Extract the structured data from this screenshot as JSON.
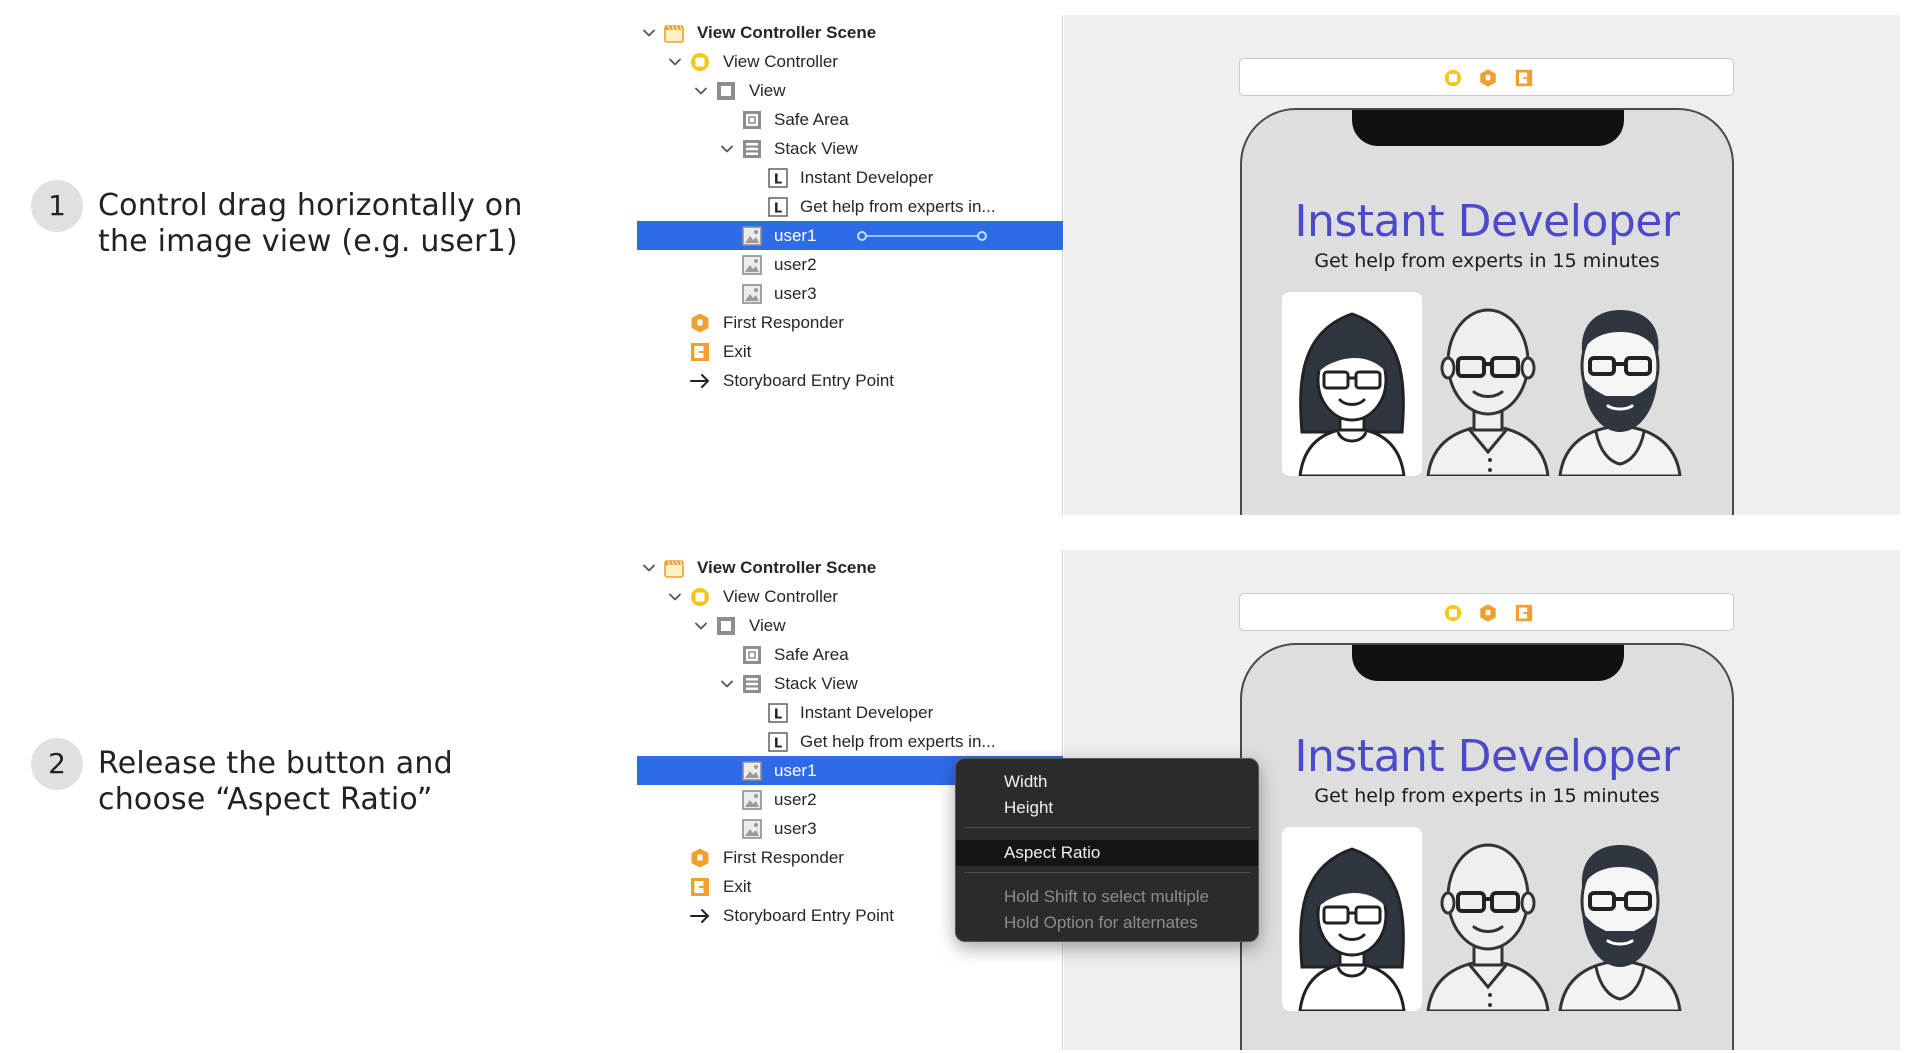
{
  "steps": [
    {
      "number": "1",
      "text_line1": "Control drag horizontally on",
      "text_line2": "the image view (e.g. user1)"
    },
    {
      "number": "2",
      "text_line1": "Release the button and",
      "text_line2": "choose “Aspect Ratio”"
    }
  ],
  "outline": {
    "scene": "View Controller Scene",
    "view_controller": "View Controller",
    "view": "View",
    "safe_area": "Safe Area",
    "stack_view": "Stack View",
    "label1": "Instant Developer",
    "label2": "Get help from experts in...",
    "user1": "user1",
    "user2": "user2",
    "user3": "user3",
    "first_responder": "First Responder",
    "exit": "Exit",
    "entry_point": "Storyboard Entry Point"
  },
  "app": {
    "title": "Instant Developer",
    "subtitle": "Get help from experts in 15 minutes"
  },
  "menu": {
    "width": "Width",
    "height": "Height",
    "aspect_ratio": "Aspect Ratio",
    "hint1": "Hold Shift to select multiple",
    "hint2": "Hold Option for alternates"
  },
  "colors": {
    "selection": "#2e6be6",
    "accent_title": "#4b4bc9",
    "icon_orange": "#f0a030",
    "icon_yellow": "#f5c518"
  }
}
